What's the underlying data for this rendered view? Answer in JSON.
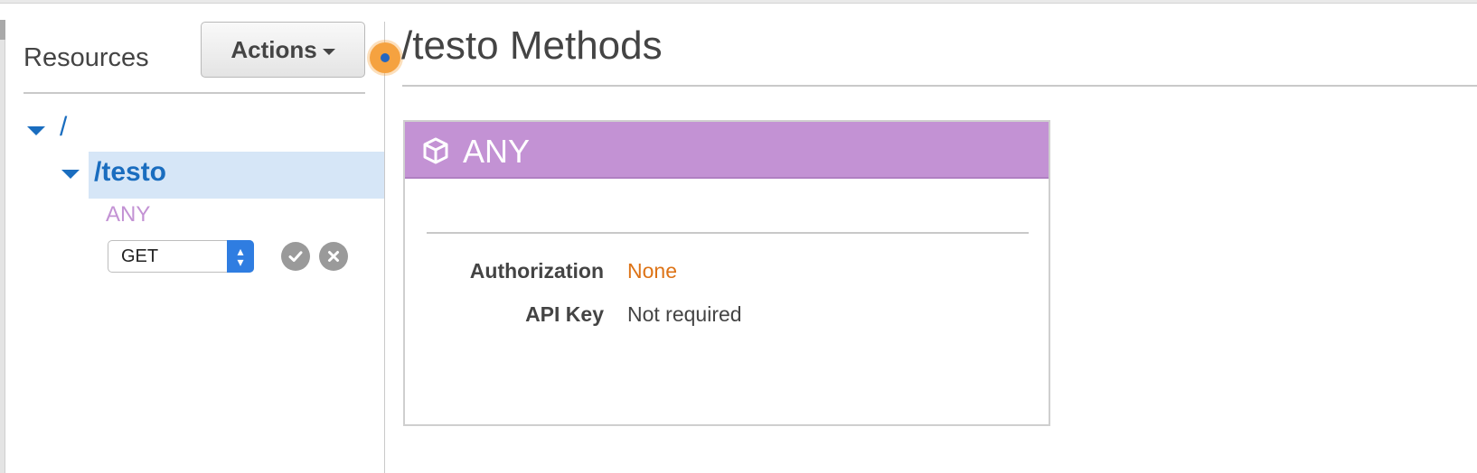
{
  "sidebar": {
    "title": "Resources",
    "actions_label": "Actions",
    "tree": {
      "root_label": "/",
      "child_label": "/testo",
      "method_label": "ANY"
    },
    "method_select": {
      "value": "GET"
    }
  },
  "main": {
    "title": "/testo Methods",
    "card": {
      "title": "ANY",
      "rows": [
        {
          "label": "Authorization",
          "value": "None"
        },
        {
          "label": "API Key",
          "value": "Not required"
        }
      ]
    }
  },
  "colors": {
    "link_blue": "#1a6dbf",
    "method_purple": "#c392d4",
    "auth_orange": "#dd7316",
    "selected_row": "#d6e6f7"
  },
  "icons": [
    "caret-down-icon",
    "tree-expand-icon",
    "select-arrows-icon",
    "checkmark-icon",
    "close-icon",
    "cube-icon"
  ]
}
